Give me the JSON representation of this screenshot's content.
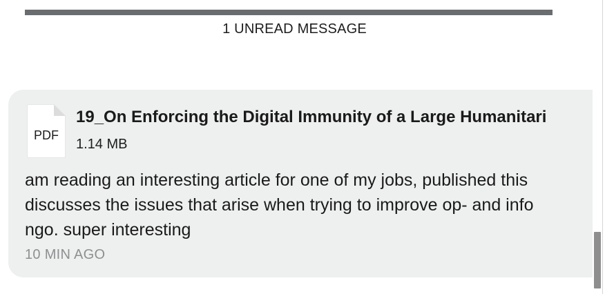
{
  "unread_divider": {
    "label": "1 UNREAD MESSAGE"
  },
  "message": {
    "attachment": {
      "icon": "pdf-file-icon",
      "type_label": "PDF",
      "file_name": "19_On Enforcing the Digital Immunity of a Large Humanitari",
      "file_size": "1.14 MB"
    },
    "body_lines": [
      "am reading an interesting article for one of my jobs, published this",
      "discusses the issues that arise when trying to improve op- and info",
      "ngo. super interesting"
    ],
    "time": "10 MIN AGO"
  },
  "colors": {
    "divider_bar": "#6a6d70",
    "bubble_background": "#eeefef",
    "timestamp_text": "#8d8f91",
    "scrollbar_thumb": "#8e8e8e"
  }
}
